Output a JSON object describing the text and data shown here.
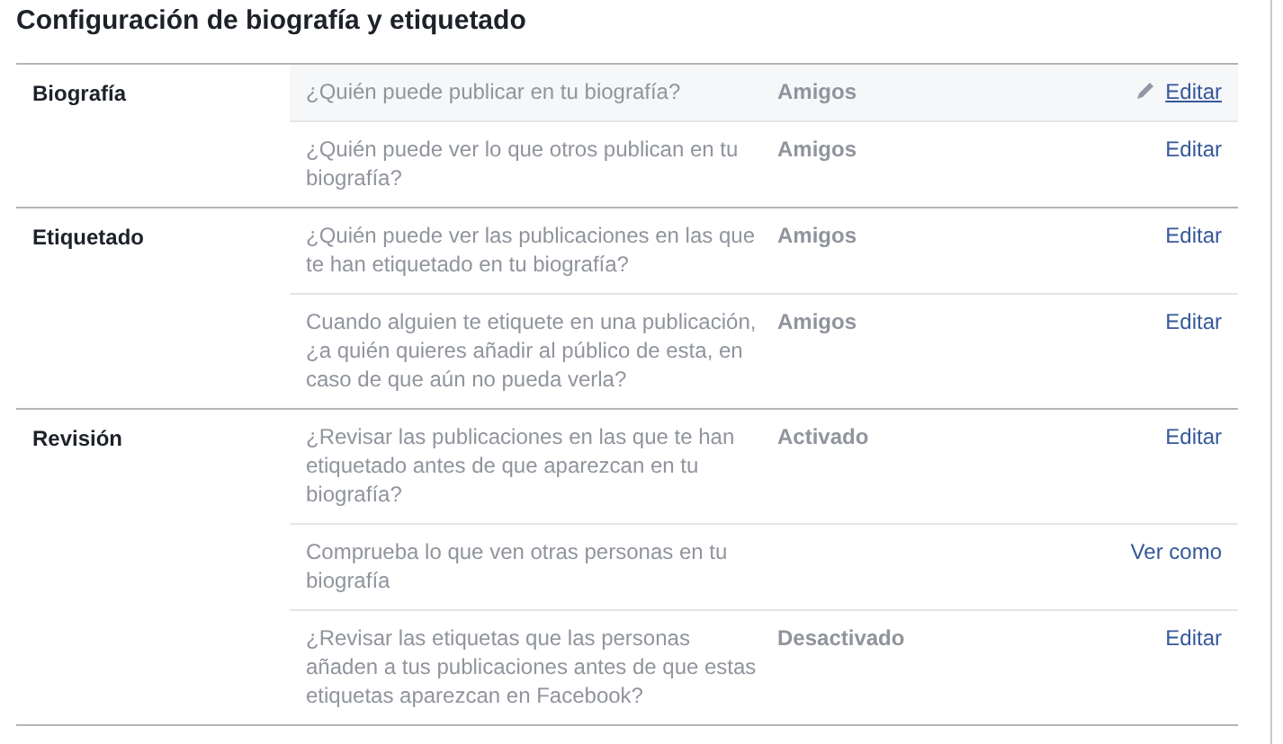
{
  "title": "Configuración de biografía y etiquetado",
  "sections": [
    {
      "label": "Biografía",
      "rows": [
        {
          "question": "¿Quién puede publicar en tu biografía?",
          "value": "Amigos",
          "action": "Editar",
          "hovered": true
        },
        {
          "question": "¿Quién puede ver lo que otros publican en tu biografía?",
          "value": "Amigos",
          "action": "Editar",
          "hovered": false
        }
      ]
    },
    {
      "label": "Etiquetado",
      "rows": [
        {
          "question": "¿Quién puede ver las publicaciones en las que te han etiquetado en tu biografía?",
          "value": "Amigos",
          "action": "Editar",
          "hovered": false
        },
        {
          "question": "Cuando alguien te etiquete en una publicación, ¿a quién quieres añadir al público de esta, en caso de que aún no pueda verla?",
          "value": "Amigos",
          "action": "Editar",
          "hovered": false
        }
      ]
    },
    {
      "label": "Revisión",
      "rows": [
        {
          "question": "¿Revisar las publicaciones en las que te han etiquetado antes de que aparezcan en tu biografía?",
          "value": "Activado",
          "action": "Editar",
          "hovered": false
        },
        {
          "question": "Comprueba lo que ven otras personas en tu biografía",
          "action": "Ver como",
          "hovered": false
        },
        {
          "question": "¿Revisar las etiquetas que las personas añaden a tus publicaciones antes de que estas etiquetas aparezcan en Facebook?",
          "value": "Desactivado",
          "action": "Editar",
          "hovered": false
        }
      ]
    }
  ]
}
